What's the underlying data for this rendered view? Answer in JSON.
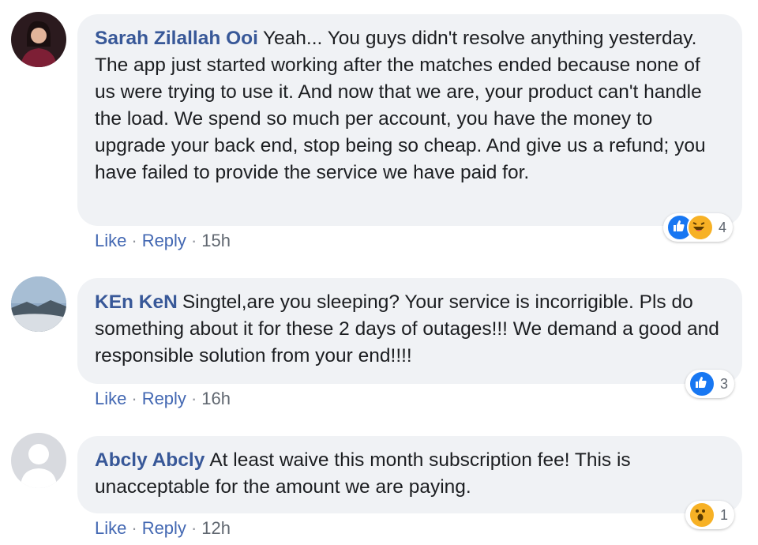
{
  "comments": [
    {
      "author": "Sarah Zilallah Ooi",
      "text": "Yeah... You guys didn't resolve anything yesterday. The app just started working after the matches ended because none of us were trying to use it. And now that we are, your product can't handle the load. We spend so much per account, you have the money to upgrade your back end, stop being so cheap. And give us a refund; you have failed to provide the service we have paid for.",
      "like_label": "Like",
      "reply_label": "Reply",
      "time": "15h",
      "reaction_icons": [
        "like-icon",
        "haha-icon"
      ],
      "reaction_count": "4"
    },
    {
      "author": "KEn KeN",
      "text": "Singtel,are you sleeping? Your service is incorrigible. Pls do something about it for these 2 days of outages!!! We demand a good and responsible solution from your end!!!!",
      "like_label": "Like",
      "reply_label": "Reply",
      "time": "16h",
      "reaction_icons": [
        "like-icon"
      ],
      "reaction_count": "3"
    },
    {
      "author": "Abcly Abcly",
      "text": "At least waive this month subscription fee! This is unacceptable for the amount we are paying.",
      "like_label": "Like",
      "reply_label": "Reply",
      "time": "12h",
      "reaction_icons": [
        "wow-icon"
      ],
      "reaction_count": "1"
    }
  ],
  "separator": "·",
  "colors": {
    "author": "#385898",
    "bubble": "#f0f2f5",
    "link": "#4267b2",
    "like_reaction": "#1877f2",
    "emoji_reaction": "#f7b125"
  }
}
